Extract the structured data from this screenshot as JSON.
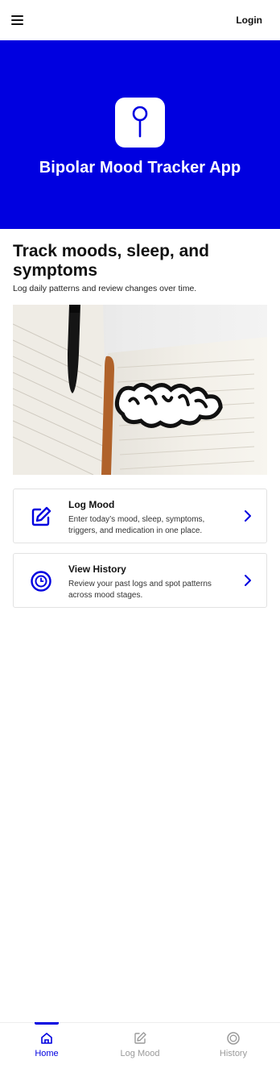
{
  "topbar": {
    "menu_icon": "hamburger-menu-icon",
    "login_label": "Login"
  },
  "hero": {
    "logo_icon": "pin-icon",
    "title": "Bipolar Mood Tracker App",
    "background": "#0000e0"
  },
  "main": {
    "heading": "Track moods, sleep, and symptoms",
    "subheading": "Log daily patterns and review changes over time.",
    "image_alt": "Notebook with pen and 'Breathe' lettering"
  },
  "cards": [
    {
      "title": "Log Mood",
      "description": "Enter today’s mood, sleep, symptoms, triggers, and medication in one place.",
      "icon": "edit-icon"
    },
    {
      "title": "View History",
      "description": "Review your past logs and spot patterns across mood stages.",
      "icon": "clock-history-icon"
    }
  ],
  "bottom_nav": {
    "items": [
      {
        "label": "Home",
        "icon": "home-icon",
        "active": true
      },
      {
        "label": "Log Mood",
        "icon": "edit-icon",
        "active": false
      },
      {
        "label": "History",
        "icon": "history-icon",
        "active": false
      }
    ]
  },
  "colors": {
    "accent": "#0000e0",
    "inactive": "#9a9a9a"
  }
}
